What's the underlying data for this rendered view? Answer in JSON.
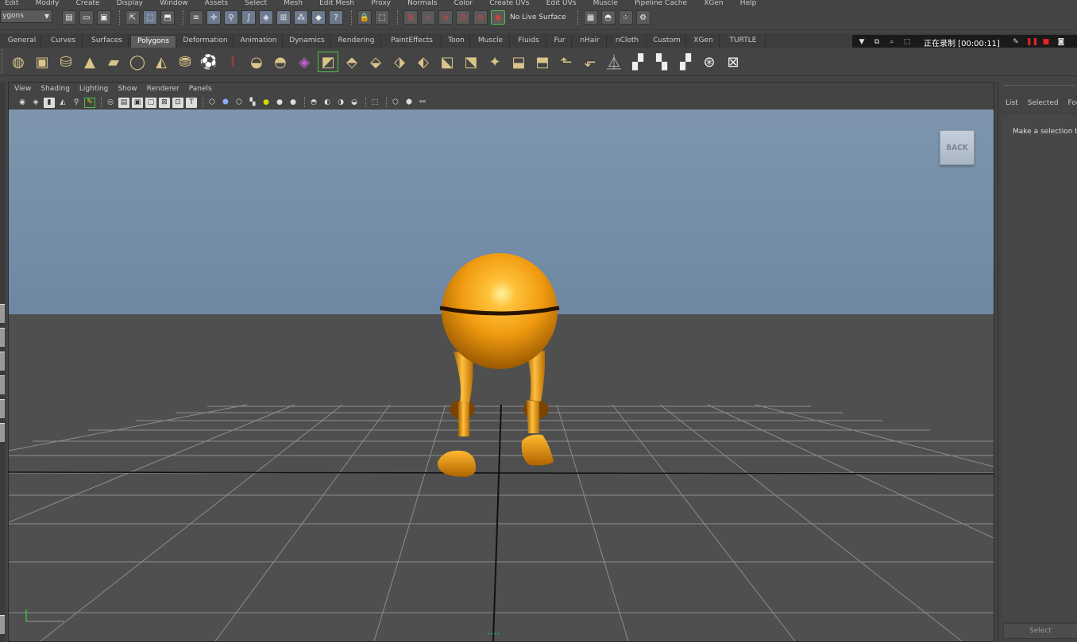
{
  "menubar": {
    "items": [
      "Edit",
      "Modify",
      "Create",
      "Display",
      "Window",
      "Assets",
      "Select",
      "Mesh",
      "Edit Mesh",
      "Proxy",
      "Normals",
      "Color",
      "Create UVs",
      "Edit UVs",
      "Muscle",
      "Pipeline Cache",
      "XGen",
      "Help"
    ]
  },
  "status_line": {
    "mode": "ygons",
    "live_surface": "No Live Surface"
  },
  "shelf_tabs": [
    "General",
    "Curves",
    "Surfaces",
    "Polygons",
    "Deformation",
    "Animation",
    "Dynamics",
    "Rendering",
    "PaintEffects",
    "Toon",
    "Muscle",
    "Fluids",
    "Fur",
    "nHair",
    "nCloth",
    "Custom",
    "XGen",
    "TURTLE"
  ],
  "active_shelf_tab": "Polygons",
  "recording": {
    "text": "正在录制 [00:00:11]"
  },
  "panel": {
    "menu": [
      "View",
      "Shading",
      "Lighting",
      "Show",
      "Renderer",
      "Panels"
    ],
    "back_label": "BACK"
  },
  "right_panel": {
    "menu": [
      "List",
      "Selected",
      "Foc"
    ],
    "message": "Make a selection to",
    "select_button": "Select"
  },
  "colors": {
    "character_orange": "#f09a10",
    "viewport_sky": "#7e95ad",
    "ground": "#4f4f4f",
    "grid": "#8d8d8d"
  }
}
